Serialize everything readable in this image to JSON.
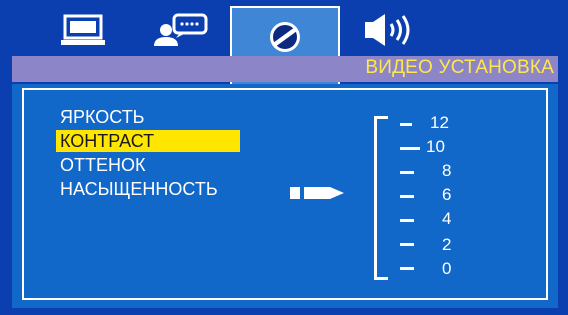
{
  "tabs": [
    {
      "icon": "monitor-icon",
      "active": false
    },
    {
      "icon": "user-keyboard-icon",
      "active": false
    },
    {
      "icon": "picture-disc-icon",
      "active": true
    },
    {
      "icon": "speaker-icon",
      "active": false
    }
  ],
  "header": {
    "title": "ВИДЕО УСТАНОВКА"
  },
  "menu": {
    "items": [
      {
        "label": "ЯРКОСТЬ",
        "selected": false
      },
      {
        "label": "КОНТРАСТ",
        "selected": true
      },
      {
        "label": "ОТТЕНОК",
        "selected": false
      },
      {
        "label": "НАСЫЩЕННОСТЬ",
        "selected": false
      }
    ]
  },
  "scale": {
    "labels": [
      "12",
      "10",
      "8",
      "6",
      "4",
      "2",
      "0"
    ]
  },
  "colors": {
    "accent_yellow": "#ffe600",
    "title_yellow": "#ffe64d",
    "panel_blue": "#1268c8",
    "frame_blue": "#0b3fb0",
    "bar_lavender": "#8c86c8",
    "active_tab": "#3f86d6"
  }
}
